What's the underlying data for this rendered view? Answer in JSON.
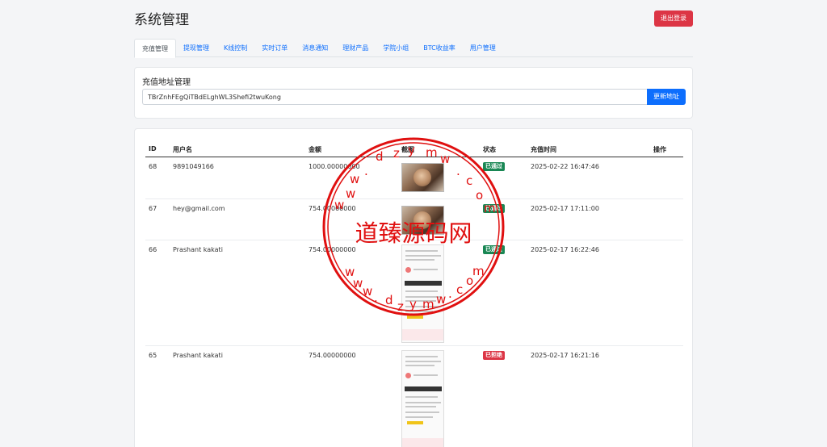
{
  "header": {
    "title": "系统管理",
    "logout_label": "退出登录"
  },
  "tabs": [
    "充值管理",
    "提现管理",
    "K线控制",
    "实时订单",
    "消息通知",
    "理财产品",
    "学院小组",
    "BTC收益率",
    "用户管理"
  ],
  "address_card": {
    "title": "充值地址管理",
    "address_value": "TBrZnhFEgQiTBdELghWL3Shefi2twuKong",
    "update_label": "更新地址"
  },
  "table": {
    "columns": [
      "ID",
      "用户名",
      "金额",
      "截图",
      "状态",
      "充值时间",
      "操作"
    ],
    "rows": [
      {
        "id": "68",
        "user": "9891049166",
        "amount": "1000.00000000",
        "status": "已通过",
        "status_type": "approved",
        "time": "2025-02-22 16:47:46"
      },
      {
        "id": "67",
        "user": "hey@gmail.com",
        "amount": "754.00000000",
        "status": "已通过",
        "status_type": "approved",
        "time": "2025-02-17 17:11:00"
      },
      {
        "id": "66",
        "user": "Prashant kakati",
        "amount": "754.00000000",
        "status": "已通过",
        "status_type": "approved",
        "time": "2025-02-17 16:22:46"
      },
      {
        "id": "65",
        "user": "Prashant kakati",
        "amount": "754.00000000",
        "status": "已拒绝",
        "status_type": "rejected",
        "time": "2025-02-17 16:21:16"
      }
    ]
  },
  "watermark": {
    "text": "道臻源码网",
    "color": "#e01010"
  }
}
